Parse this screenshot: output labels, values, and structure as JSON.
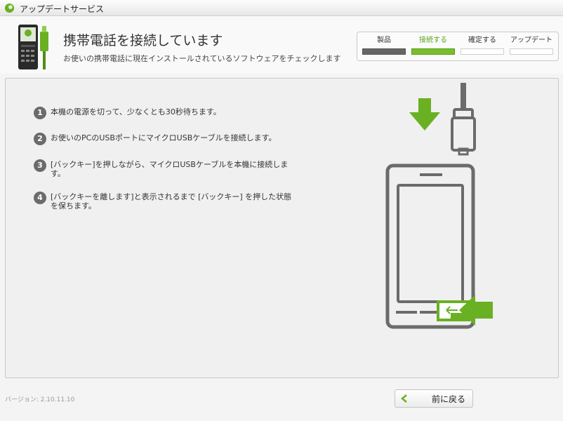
{
  "window": {
    "title": "アップデートサービス"
  },
  "header": {
    "title": "携帯電話を接続しています",
    "subtitle": "お使いの携帯電話に現在インストールされているソフトウェアをチェックします"
  },
  "steps": [
    {
      "label": "製品",
      "state": "done"
    },
    {
      "label": "接続する",
      "state": "active"
    },
    {
      "label": "確定する",
      "state": "pending"
    },
    {
      "label": "アップデート",
      "state": "pending"
    }
  ],
  "instructions": [
    {
      "num": "1",
      "text": "本機の電源を切って、少なくとも30秒待ちます。"
    },
    {
      "num": "2",
      "text": "お使いのPCのUSBポートにマイクロUSBケーブルを接続します。"
    },
    {
      "num": "3",
      "text": "[バックキー]を押しながら、マイクロUSBケーブルを本機に接続します。"
    },
    {
      "num": "4",
      "text": "[バックキーを離します]と表示されるまで [バックキー] を押した状態を保ちます。"
    }
  ],
  "footer": {
    "version": "バージョン: 2.10.11.10",
    "back_label": "前に戻る"
  },
  "colors": {
    "accent": "#6ab023",
    "dark": "#6b6b6b"
  },
  "icons": {
    "app": "app-logo-icon",
    "phone": "phone-usb-icon",
    "back": "chevron-left-icon",
    "arrow": "arrow-down-icon"
  }
}
